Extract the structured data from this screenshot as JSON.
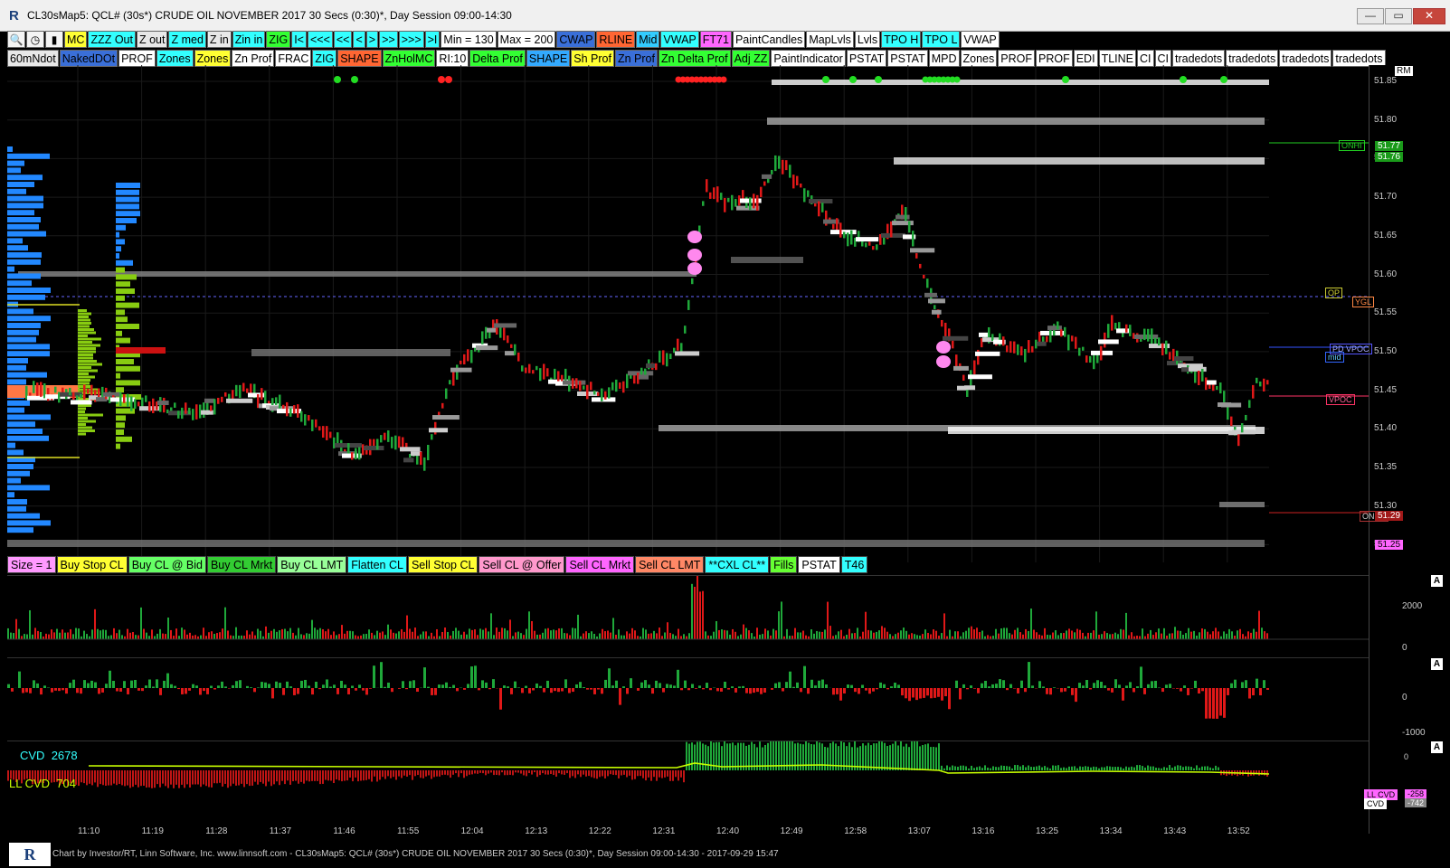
{
  "window": {
    "title": "CL30sMap5: QCL# (30s*) CRUDE OIL NOVEMBER 2017 30 Secs (0:30)*, Day Session 09:00-14:30",
    "minimize": "—",
    "maximize": "▭",
    "close": "✕"
  },
  "toolbar1": [
    {
      "label": "MC",
      "bg": "#ffff33"
    },
    {
      "label": "ZZZ Out",
      "bg": "#33ffff"
    },
    {
      "label": "Z out",
      "bg": "#e8e8e8"
    },
    {
      "label": "Z med",
      "bg": "#33ffff"
    },
    {
      "label": "Z in",
      "bg": "#e8e8e8"
    },
    {
      "label": "Zin in",
      "bg": "#33ffff"
    },
    {
      "label": "ZIG",
      "bg": "#33ff33"
    },
    {
      "label": "I<",
      "bg": "#33ffff"
    },
    {
      "label": "<<<",
      "bg": "#33ffff"
    },
    {
      "label": "<<",
      "bg": "#33ffff"
    },
    {
      "label": "<",
      "bg": "#33ffff"
    },
    {
      "label": ">",
      "bg": "#33ffff"
    },
    {
      "label": ">>",
      "bg": "#33ffff"
    },
    {
      "label": ">>>",
      "bg": "#33ffff"
    },
    {
      "label": ">I",
      "bg": "#33ffff"
    },
    {
      "label": "Min = 130",
      "bg": "#ffffff"
    },
    {
      "label": "Max = 200",
      "bg": "#ffffff"
    },
    {
      "label": "CWAP",
      "bg": "#3a6fd8"
    },
    {
      "label": "RLINE",
      "bg": "#ff6633"
    },
    {
      "label": "Mid",
      "bg": "#33ccff"
    },
    {
      "label": "VWAP",
      "bg": "#33ffff"
    },
    {
      "label": "FT71",
      "bg": "#ff66ff"
    },
    {
      "label": "PaintCandles",
      "bg": "#ffffff"
    },
    {
      "label": "MapLvls",
      "bg": "#ffffff"
    },
    {
      "label": "Lvls",
      "bg": "#ffffff"
    },
    {
      "label": "TPO H",
      "bg": "#33ffff"
    },
    {
      "label": "TPO L",
      "bg": "#33ffff"
    },
    {
      "label": "VWAP",
      "bg": "#ffffff"
    }
  ],
  "toolbar2": [
    {
      "label": "60mNdot",
      "bg": "#e8e8e8"
    },
    {
      "label": "NakedDOt",
      "bg": "#3a6fd8"
    },
    {
      "label": "PROF",
      "bg": "#ffffff"
    },
    {
      "label": "Zones",
      "bg": "#33ffff"
    },
    {
      "label": "Zones",
      "bg": "#ffff33"
    },
    {
      "label": "Zn Prof",
      "bg": "#ffffff"
    },
    {
      "label": "FRAC",
      "bg": "#ffffff"
    },
    {
      "label": "ZIG",
      "bg": "#33ffff"
    },
    {
      "label": "SHAPE",
      "bg": "#ff6633"
    },
    {
      "label": "ZnHolMC",
      "bg": "#33ff33"
    },
    {
      "label": "RI:10",
      "bg": "#ffffff"
    },
    {
      "label": "Delta Prof",
      "bg": "#33ff33"
    },
    {
      "label": "SHAPE",
      "bg": "#33aaff"
    },
    {
      "label": "Sh Prof",
      "bg": "#ffff33"
    },
    {
      "label": "Zn Prof",
      "bg": "#3a6fd8"
    },
    {
      "label": "Zn Delta Prof",
      "bg": "#33ff33"
    },
    {
      "label": "Adj ZZ",
      "bg": "#33ff33"
    },
    {
      "label": "PaintIndicator",
      "bg": "#ffffff"
    },
    {
      "label": "PSTAT",
      "bg": "#ffffff"
    },
    {
      "label": "PSTAT",
      "bg": "#ffffff"
    },
    {
      "label": "MPD",
      "bg": "#ffffff"
    },
    {
      "label": "Zones",
      "bg": "#ffffff"
    },
    {
      "label": "PROF",
      "bg": "#ffffff"
    },
    {
      "label": "PROF",
      "bg": "#ffffff"
    },
    {
      "label": "EDI",
      "bg": "#ffffff"
    },
    {
      "label": "TLINE",
      "bg": "#ffffff"
    },
    {
      "label": "CI",
      "bg": "#ffffff"
    },
    {
      "label": "CI",
      "bg": "#ffffff"
    },
    {
      "label": "tradedots",
      "bg": "#ffffff"
    },
    {
      "label": "tradedots",
      "bg": "#ffffff"
    },
    {
      "label": "tradedots",
      "bg": "#ffffff"
    },
    {
      "label": "tradedots",
      "bg": "#ffffff"
    }
  ],
  "price_axis": {
    "corner": "RM",
    "ticks": [
      "51.85",
      "51.80",
      "51.75",
      "51.70",
      "51.65",
      "51.60",
      "51.55",
      "51.50",
      "51.45",
      "51.40",
      "51.35",
      "51.30",
      "51.25"
    ],
    "last_price": "51.25",
    "onhi_price": "51.77",
    "onhi_price2": "51.76",
    "onlo_price": "51.29"
  },
  "level_tags": {
    "onhi": "ONHI",
    "op": "OP",
    "ygl": "YGL",
    "pdvpoc": "PD VPOC",
    "mid": "mid",
    "vpoc": "VPOC",
    "onlo": "ONLO"
  },
  "order_bar": [
    {
      "label": "Size = 1",
      "bg": "#ff99ff"
    },
    {
      "label": "Buy Stop CL",
      "bg": "#ffff33"
    },
    {
      "label": "Buy CL @ Bid",
      "bg": "#66ff66"
    },
    {
      "label": "Buy CL Mrkt",
      "bg": "#33cc33"
    },
    {
      "label": "Buy CL LMT",
      "bg": "#99ff99"
    },
    {
      "label": "Flatten CL",
      "bg": "#33ffff"
    },
    {
      "label": "Sell Stop CL",
      "bg": "#ffff33"
    },
    {
      "label": "Sell CL @ Offer",
      "bg": "#ff99cc"
    },
    {
      "label": "Sell CL Mrkt",
      "bg": "#ff66ff"
    },
    {
      "label": "Sell CL LMT",
      "bg": "#ff8866"
    },
    {
      "label": "**CXL CL**",
      "bg": "#33ffff"
    },
    {
      "label": "Fills",
      "bg": "#66ff33"
    },
    {
      "label": "PSTAT",
      "bg": "#ffffff"
    },
    {
      "label": "T46",
      "bg": "#33ffff"
    }
  ],
  "volume_pane": {
    "ticks": [
      "2000",
      "0"
    ],
    "autoscale": "A"
  },
  "delta_pane": {
    "ticks": [
      "0",
      "-1000"
    ],
    "autoscale": "A"
  },
  "cvd_pane": {
    "cvd_label": "CVD",
    "cvd_value": "2678",
    "llcvd_label": "LL CVD",
    "llcvd_value": "704",
    "autoscale": "A",
    "right_tags": {
      "llcvd": "LL CVD",
      "cvd": "CVD",
      "v1": "-258",
      "v2": "-742",
      "top": "0"
    }
  },
  "time_axis": [
    "11:10",
    "11:19",
    "11:28",
    "11:37",
    "11:46",
    "11:55",
    "12:04",
    "12:13",
    "12:22",
    "12:31",
    "12:40",
    "12:49",
    "12:58",
    "13:07",
    "13:16",
    "13:25",
    "13:34",
    "13:43",
    "13:52"
  ],
  "footer": {
    "logo": "R",
    "text": "Chart by Investor/RT, Linn Software, Inc. www.linnsoft.com - CL30sMap5: QCL# (30s*) CRUDE OIL NOVEMBER 2017 30 Secs (0:30)*, Day Session 09:00-14:30 - 2017-09-29 15:47"
  },
  "colors": {
    "up": "#1fa83a",
    "down": "#e01818",
    "cvd_line": "#c8ff00",
    "profile_blue": "#2288ff",
    "profile_green": "#88cc11"
  }
}
